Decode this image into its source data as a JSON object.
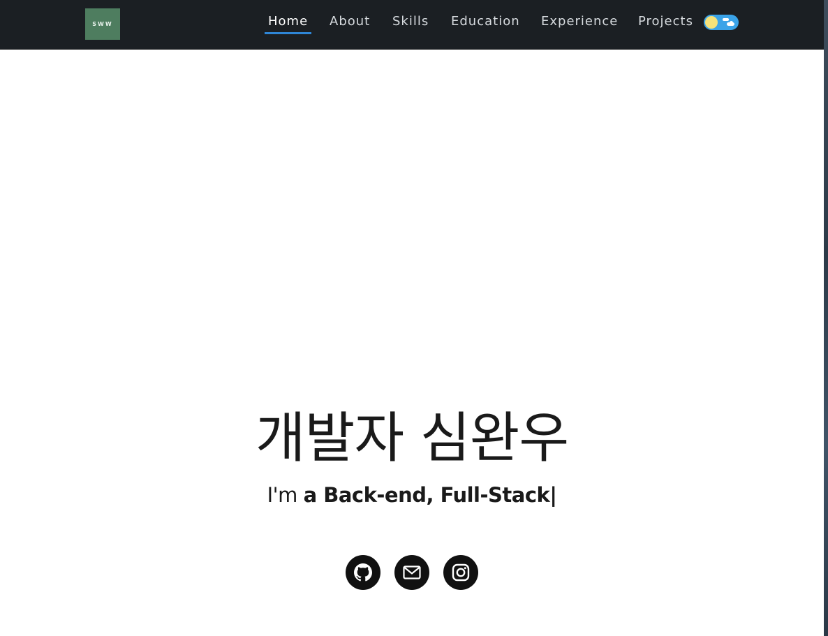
{
  "navbar": {
    "logo_text": "SWW",
    "links": [
      {
        "label": "Home",
        "active": true
      },
      {
        "label": "About"
      },
      {
        "label": "Skills"
      },
      {
        "label": "Education"
      },
      {
        "label": "Experience"
      },
      {
        "label": "Projects"
      }
    ],
    "theme_toggle": {
      "state": "light",
      "icon": "sun-cloud-icon"
    }
  },
  "hero": {
    "title": "개발자 심완우",
    "subtitle_prefix": "I'm ",
    "subtitle_emphasis": "a Back-end, Full-Stack",
    "cursor": "|"
  },
  "social": [
    {
      "name": "github",
      "icon": "github-icon"
    },
    {
      "name": "email",
      "icon": "mail-icon"
    },
    {
      "name": "instagram",
      "icon": "instagram-icon"
    }
  ],
  "colors": {
    "navbar_bg": "#1b1f23",
    "active_underline": "#2f86d6",
    "logo_bg": "#4e7d5f",
    "toggle_bg": "#3aa3e8",
    "sun": "#f5e27a",
    "social_bg": "#111111"
  }
}
